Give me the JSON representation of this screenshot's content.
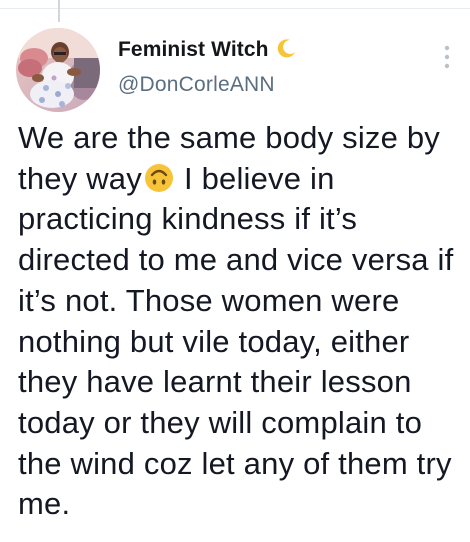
{
  "tweet": {
    "author": {
      "display_name": "Feminist Witch",
      "name_emoji": "crescent-moon-icon",
      "handle": "@DonCorleANN"
    },
    "text_before_emoji": "We are the same body size by they way",
    "inline_emoji": "upside-down-face-icon",
    "text_after_emoji": "I believe in practicing kindness if it’s directed to me and vice versa if it’s not. Those women were nothing but vile today, either they have learnt their lesson today or they will complain to the wind coz let any of them try me."
  },
  "colors": {
    "name_text": "#14171a",
    "handle_text": "#5b6f80",
    "body_text": "#141823",
    "divider": "#e6ecf0",
    "emoji_yellow": "#f7c339"
  }
}
